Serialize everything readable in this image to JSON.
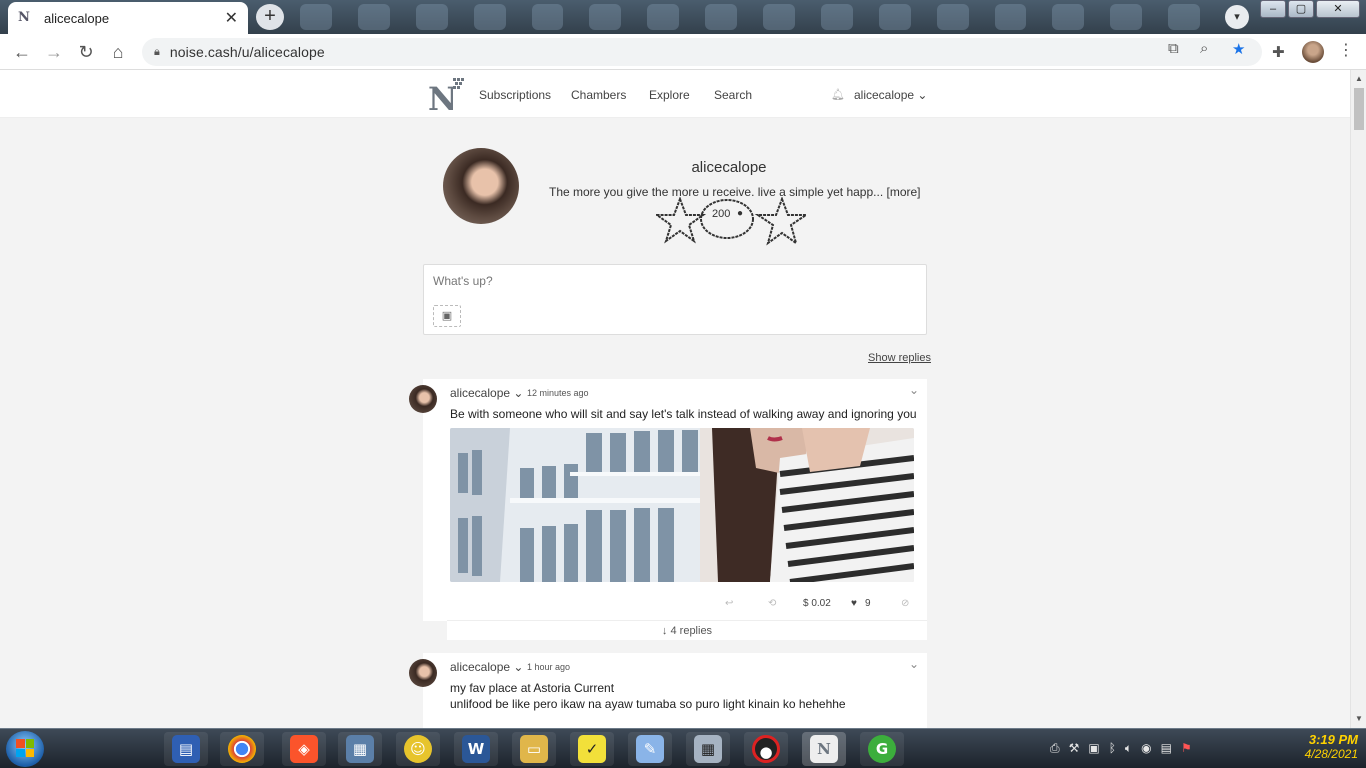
{
  "browser": {
    "tab_title": "alicecalope",
    "tab_favicon": "N",
    "new_tab_symbol": "+",
    "url": "noise.cash/u/alicecalope"
  },
  "site": {
    "nav": [
      {
        "label": "Subscriptions"
      },
      {
        "label": "Chambers"
      },
      {
        "label": "Explore"
      },
      {
        "label": "Search"
      }
    ],
    "username_menu": "alicecalope"
  },
  "profile": {
    "name": "alicecalope",
    "bio": "The more you give the more u receive. live a simple yet happ... [more]",
    "followers": "200"
  },
  "composer": {
    "placeholder": "What's up?"
  },
  "show_replies": "Show replies",
  "posts": [
    {
      "author": "alicecalope",
      "time": "12 minutes ago",
      "text": "Be with someone who will sit and say let's talk instead of walking away and ignoring you",
      "tip_amount": "$ 0.02",
      "likes": "9",
      "replies": "4 replies"
    },
    {
      "author": "alicecalope",
      "time": "1 hour ago",
      "text_line1": "my fav place at Astoria Current",
      "text_line2": "unlifood be like pero ikaw na ayaw tumaba so puro light kinain ko hehehhe"
    }
  ],
  "taskbar": {
    "apps": [
      "file-manager",
      "chrome",
      "brave",
      "photo-editor",
      "emoji-app",
      "word",
      "explorer",
      "sticky-notes",
      "paint",
      "calculator",
      "recorder",
      "noise-cash",
      "g-app"
    ],
    "clock_time": "3:19 PM",
    "clock_date": "4/28/2021"
  }
}
